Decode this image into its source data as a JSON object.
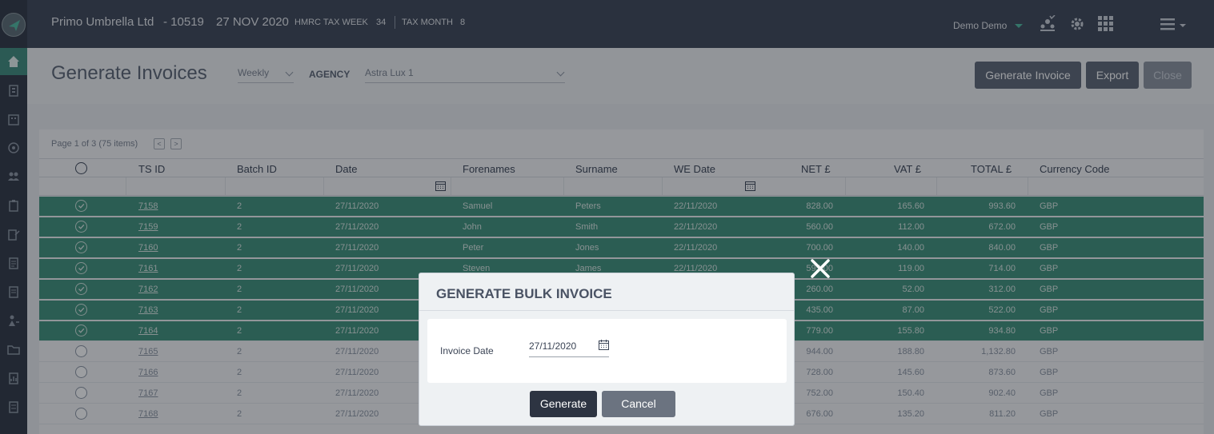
{
  "topbar": {
    "company": "Primo Umbrella Ltd",
    "company_id": "- 10519",
    "date": "27 NOV 2020",
    "tax_week_label": "HMRC TAX WEEK",
    "tax_week_value": "34",
    "tax_month_label": "TAX MONTH",
    "tax_month_value": "8",
    "user": "Demo Demo"
  },
  "header": {
    "title": "Generate Invoices",
    "period": "Weekly",
    "agency_label": "AGENCY",
    "agency": "Astra Lux 1",
    "generate_invoice_label": "Generate Invoice",
    "export_label": "Export",
    "close_label": "Close"
  },
  "grid": {
    "pager": "Page 1 of 3 (75 items)",
    "prev": "<",
    "next": ">",
    "columns": [
      "TS ID",
      "Batch ID",
      "Date",
      "Forenames",
      "Surname",
      "WE Date",
      "NET £",
      "VAT £",
      "TOTAL £",
      "Currency Code"
    ],
    "rows": [
      {
        "selected": true,
        "ts_id": "7158",
        "batch": "2",
        "date": "27/11/2020",
        "forenames": "Samuel",
        "surname": "Peters",
        "we_date": "22/11/2020",
        "net": "828.00",
        "vat": "165.60",
        "total": "993.60",
        "currency": "GBP"
      },
      {
        "selected": true,
        "ts_id": "7159",
        "batch": "2",
        "date": "27/11/2020",
        "forenames": "John",
        "surname": "Smith",
        "we_date": "22/11/2020",
        "net": "560.00",
        "vat": "112.00",
        "total": "672.00",
        "currency": "GBP"
      },
      {
        "selected": true,
        "ts_id": "7160",
        "batch": "2",
        "date": "27/11/2020",
        "forenames": "Peter",
        "surname": "Jones",
        "we_date": "22/11/2020",
        "net": "700.00",
        "vat": "140.00",
        "total": "840.00",
        "currency": "GBP"
      },
      {
        "selected": true,
        "ts_id": "7161",
        "batch": "2",
        "date": "27/11/2020",
        "forenames": "Steven",
        "surname": "James",
        "we_date": "22/11/2020",
        "net": "595.00",
        "vat": "119.00",
        "total": "714.00",
        "currency": "GBP"
      },
      {
        "selected": true,
        "ts_id": "7162",
        "batch": "2",
        "date": "27/11/2020",
        "forenames": "",
        "surname": "",
        "we_date": "",
        "net": "260.00",
        "vat": "52.00",
        "total": "312.00",
        "currency": "GBP"
      },
      {
        "selected": true,
        "ts_id": "7163",
        "batch": "2",
        "date": "27/11/2020",
        "forenames": "",
        "surname": "",
        "we_date": "",
        "net": "435.00",
        "vat": "87.00",
        "total": "522.00",
        "currency": "GBP"
      },
      {
        "selected": true,
        "ts_id": "7164",
        "batch": "2",
        "date": "27/11/2020",
        "forenames": "",
        "surname": "",
        "we_date": "",
        "net": "779.00",
        "vat": "155.80",
        "total": "934.80",
        "currency": "GBP"
      },
      {
        "selected": false,
        "ts_id": "7165",
        "batch": "2",
        "date": "27/11/2020",
        "forenames": "",
        "surname": "",
        "we_date": "",
        "net": "944.00",
        "vat": "188.80",
        "total": "1,132.80",
        "currency": "GBP"
      },
      {
        "selected": false,
        "ts_id": "7166",
        "batch": "2",
        "date": "27/11/2020",
        "forenames": "",
        "surname": "",
        "we_date": "",
        "net": "728.00",
        "vat": "145.60",
        "total": "873.60",
        "currency": "GBP"
      },
      {
        "selected": false,
        "ts_id": "7167",
        "batch": "2",
        "date": "27/11/2020",
        "forenames": "",
        "surname": "",
        "we_date": "",
        "net": "752.00",
        "vat": "150.40",
        "total": "902.40",
        "currency": "GBP"
      },
      {
        "selected": false,
        "ts_id": "7168",
        "batch": "2",
        "date": "27/11/2020",
        "forenames": "",
        "surname": "",
        "we_date": "",
        "net": "676.00",
        "vat": "135.20",
        "total": "811.20",
        "currency": "GBP"
      }
    ]
  },
  "modal": {
    "title": "GENERATE BULK INVOICE",
    "invoice_date_label": "Invoice Date",
    "invoice_date_value": "27/11/2020",
    "generate_label": "Generate",
    "cancel_label": "Cancel"
  },
  "colors": {
    "topbar": "#3b4455",
    "accent": "#3d8f79",
    "primary_button": "#2d3442",
    "secondary_button": "#6b7380"
  }
}
